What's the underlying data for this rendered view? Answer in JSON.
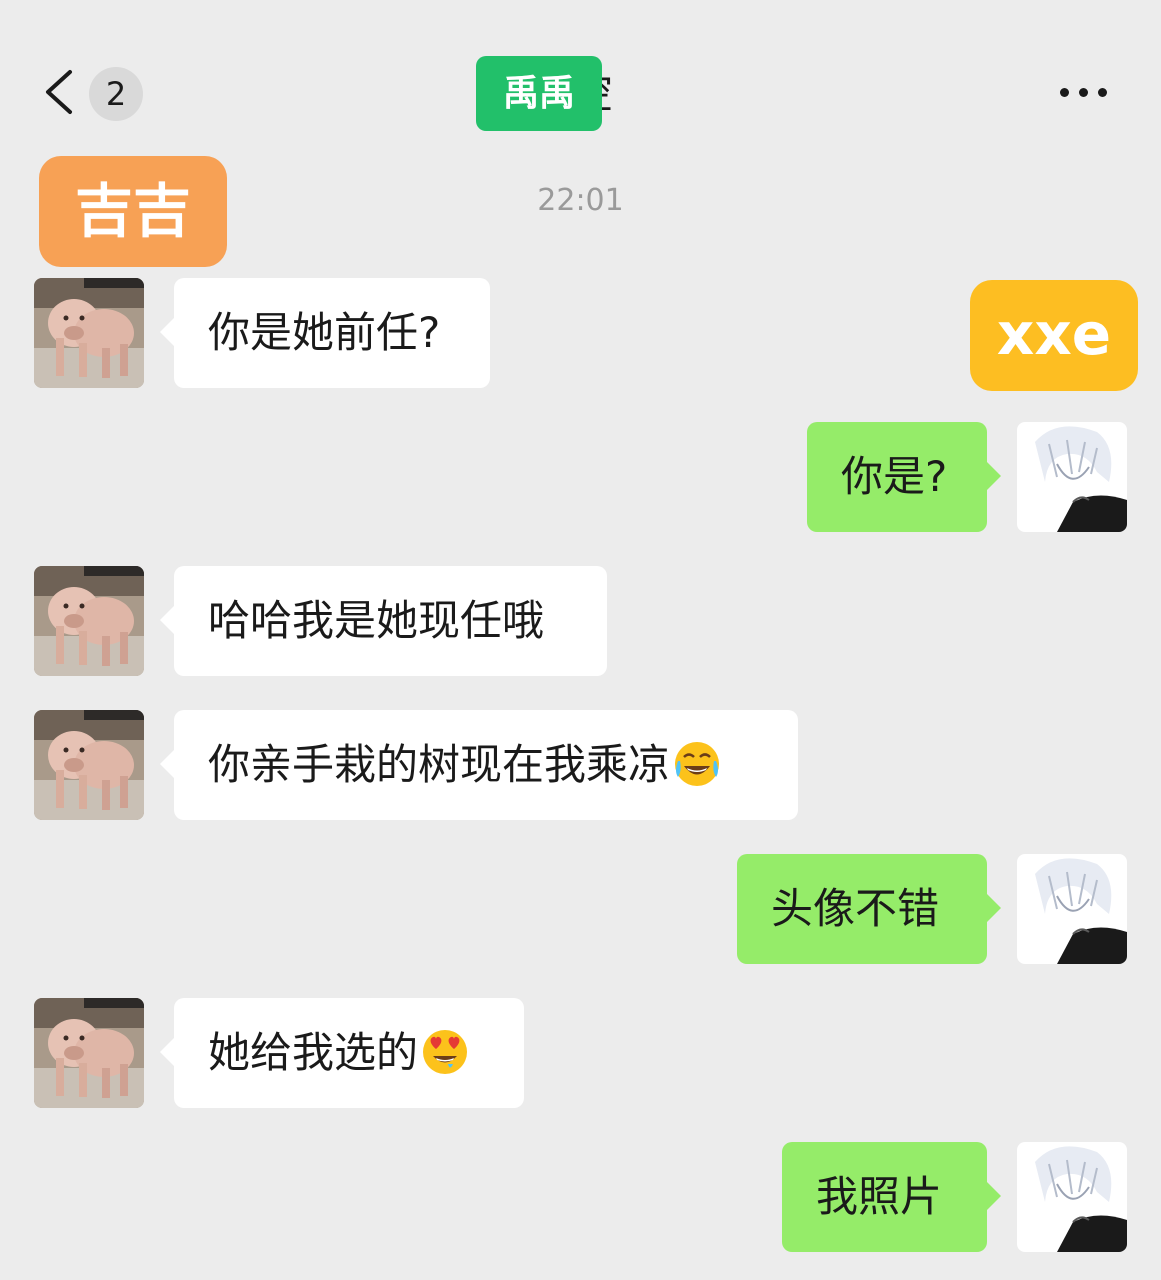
{
  "header": {
    "unread_count": "2",
    "title_visible_part": "控",
    "title_cover_text": "禹禹"
  },
  "annotations": {
    "left_user_tag": "吉吉",
    "right_user_tag": "xxe"
  },
  "timestamp": "22:01",
  "colors": {
    "background": "#ececec",
    "bubble_incoming": "#ffffff",
    "bubble_outgoing": "#95ec69",
    "title_cover": "#22c06a",
    "left_tag": "#f7a155",
    "right_tag": "#fdbe22"
  },
  "messages": [
    {
      "side": "left",
      "text": "你是她前任?"
    },
    {
      "side": "right",
      "text": "你是?"
    },
    {
      "side": "left",
      "text": "哈哈我是她现任哦"
    },
    {
      "side": "left",
      "text": "你亲手栽的树现在我乘凉",
      "emoji": "tears-of-joy-emoji"
    },
    {
      "side": "right",
      "text": "头像不错"
    },
    {
      "side": "left",
      "text": "她给我选的",
      "emoji": "heart-eyes-emoji"
    },
    {
      "side": "right",
      "text": "我照片"
    }
  ],
  "icons": {
    "back": "chevron-left-icon",
    "more": "more-dots-icon",
    "left_avatar": "pig-avatar",
    "right_avatar": "anime-avatar"
  }
}
